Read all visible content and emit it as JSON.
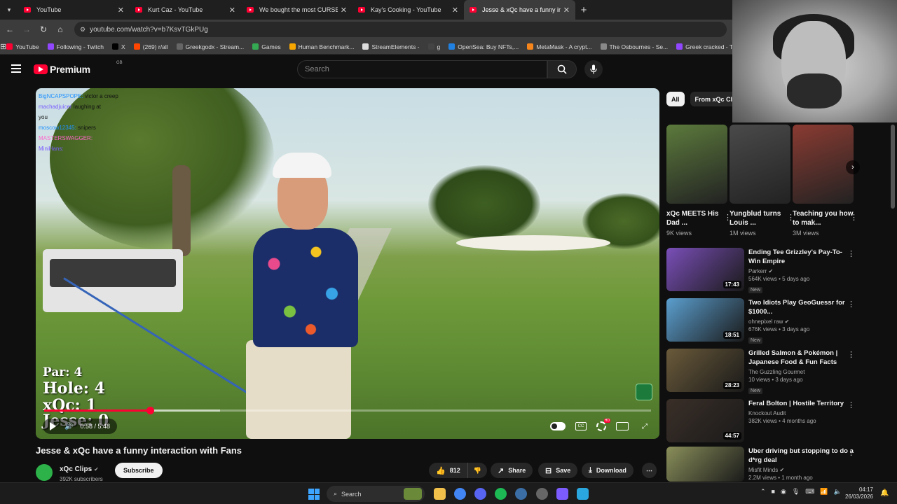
{
  "browser": {
    "tabs": [
      {
        "title": "YouTube"
      },
      {
        "title": "Kurt Caz - YouTube"
      },
      {
        "title": "We bought the most CURSED T"
      },
      {
        "title": "Kay's Cooking - YouTube"
      },
      {
        "title": "Jesse & xQc have a funny intera"
      }
    ],
    "url": "youtube.com/watch?v=b7KsvTGkPUg",
    "bookmarks": [
      {
        "label": "YouTube",
        "color": "#ff0033"
      },
      {
        "label": "Following - Twitch",
        "color": "#9146ff"
      },
      {
        "label": "X",
        "color": "#000000"
      },
      {
        "label": "(269) r/all",
        "color": "#ff4500"
      },
      {
        "label": "Greekgodx - Stream...",
        "color": "#666666"
      },
      {
        "label": "Games",
        "color": "#34a853"
      },
      {
        "label": "Human Benchmark...",
        "color": "#f7a600"
      },
      {
        "label": "StreamElements -",
        "color": "#dddddd"
      },
      {
        "label": "g",
        "color": "#444444"
      },
      {
        "label": "OpenSea: Buy NFTs,...",
        "color": "#2081e2"
      },
      {
        "label": "MetaMask - A crypt...",
        "color": "#f6851b"
      },
      {
        "label": "The Osbournes - Se...",
        "color": "#888888"
      },
      {
        "label": "Greek cracked - Twi...",
        "color": "#9146ff"
      }
    ]
  },
  "header": {
    "logo_text": "Premium",
    "country_code": "GB",
    "search_placeholder": "Search"
  },
  "player": {
    "chat": [
      {
        "user": "BigNCAPSPOPE:",
        "msg": "victor a creep"
      },
      {
        "user": "machadjuicer",
        "msg": "laughing at"
      },
      {
        "user": "you",
        "msg": ""
      },
      {
        "user": "moscow12345:",
        "msg": "snipers"
      },
      {
        "user": "MASTERSWAGGER:",
        "msg": ""
      },
      {
        "user": "MiniHans:",
        "msg": ""
      }
    ],
    "score": {
      "par": "Par: 4",
      "hole": "Hole: 4",
      "xqc": "xQc: 1",
      "jesse": "Jesse: 0"
    },
    "time": "0:58 / 5:48",
    "progress_fraction": 0.174,
    "buffered_fraction": 0.29
  },
  "video": {
    "title": "Jesse & xQc have a funny interaction with Fans",
    "channel": "xQc Clips",
    "subscribers": "392K subscribers",
    "subscribe_label": "Subscribe",
    "likes": "812",
    "share_label": "Share",
    "save_label": "Save",
    "download_label": "Download"
  },
  "sidebar": {
    "chips": [
      {
        "label": "All"
      },
      {
        "label": "From xQc Cli"
      }
    ],
    "shorts": [
      {
        "title": "xQc MEETS His Dad ...",
        "views": "9K views",
        "color": "#5c7a3c"
      },
      {
        "title": "Yungblud turns Louis ...",
        "views": "1M views",
        "color": "#4a4a4a"
      },
      {
        "title": "Teaching you how to mak...",
        "views": "3M views",
        "color": "#8a3b32"
      }
    ],
    "recommendations": [
      {
        "title": "Ending Tee Grizzley's Pay-To-Win Empire",
        "channel": "Parkerr",
        "meta": "564K views • 5 days ago",
        "badge": "New",
        "duration": "17:43",
        "color": "#7a4fb8"
      },
      {
        "title": "Two Idiots Play GeoGuessr for $1000...",
        "channel": "ohnepixel raw",
        "meta": "676K views • 3 days ago",
        "badge": "New",
        "duration": "18:51",
        "color": "#5b9fcf"
      },
      {
        "title": "Grilled Salmon & Pokémon | Japanese Food & Fun Facts",
        "channel": "The Guzzling Gourmet",
        "meta": "10 views • 3 days ago",
        "badge": "New",
        "duration": "28:23",
        "color": "#6a5a3a"
      },
      {
        "title": "Feral Bolton | Hostile Territory",
        "channel": "Knockout Audit",
        "meta": "382K views • 4 months ago",
        "badge": "",
        "duration": "44:57",
        "color": "#3a2f28"
      },
      {
        "title": "Uber driving but stopping to do a d*rg deal",
        "channel": "Misfit Minds",
        "meta": "2.2M views • 1 month ago",
        "badge": "",
        "duration": "",
        "color": "#8a8f5a"
      }
    ]
  },
  "taskbar": {
    "search_label": "Search",
    "time": "04:17",
    "date": "26/03/2026"
  }
}
